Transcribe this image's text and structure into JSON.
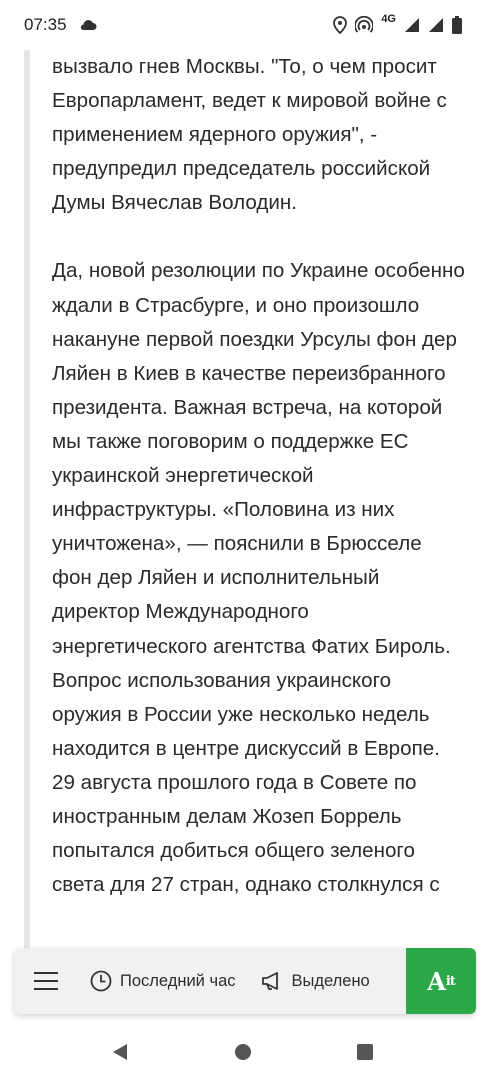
{
  "status_bar": {
    "time": "07:35",
    "network": "4G"
  },
  "article": {
    "paragraph_1": "вызвало гнев Москвы. \"То, о чем просит Европарламент, ведет к мировой войне с применением ядерного оружия\", - предупредил председатель российской Думы Вячеслав Володин.",
    "paragraph_2": "Да, новой резолюции по Украине особенно ждали в Страсбурге, и оно произошло накануне первой поездки Урсулы фон дер Ляйен в Киев в качестве переизбранного президента. Важная встреча, на которой мы также поговорим о поддержке ЕС украинской энергетической инфраструктуры. «Половина из них уничтожена», — пояснили в Брюсселе фон дер Ляйен и исполнительный директор Международного энергетического агентства Фатих Бироль.",
    "paragraph_3": "Вопрос использования украинского оружия в России уже несколько недель находится в центре дискуссий в Европе. 29 августа прошлого года в Совете по иностранным делам Жозеп Боррель попытался добиться общего зеленого света для 27 стран, однако столкнулся с"
  },
  "toolbar": {
    "last_hour_label": "Последний час",
    "highlighted_label": "Выделено",
    "logo_text": "A",
    "logo_suffix": "it"
  },
  "colors": {
    "accent": "#2ba84a",
    "toolbar_bg": "#f1f1f1"
  }
}
